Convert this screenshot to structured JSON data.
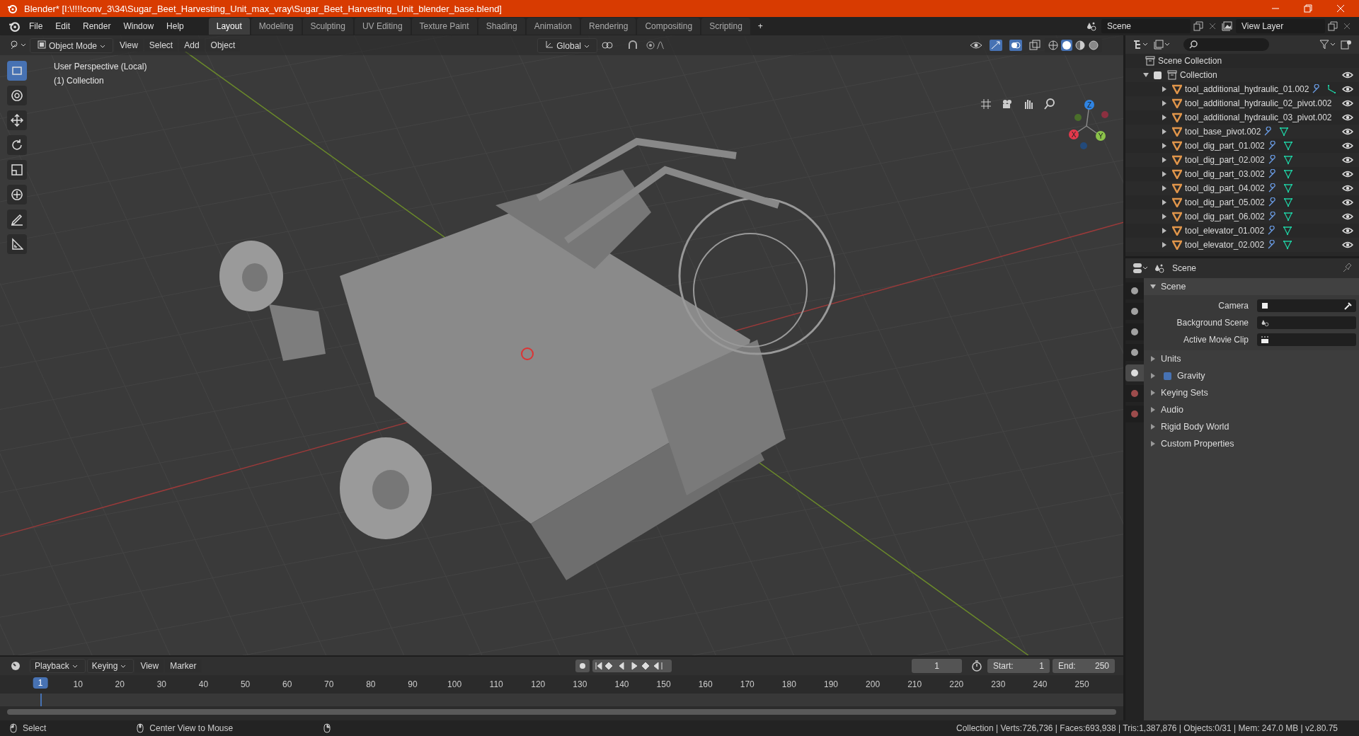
{
  "window": {
    "title": "Blender* [I:\\!!!!conv_3\\34\\Sugar_Beet_Harvesting_Unit_max_vray\\Sugar_Beet_Harvesting_Unit_blender_base.blend]"
  },
  "menu": [
    "File",
    "Edit",
    "Render",
    "Window",
    "Help"
  ],
  "workspaces": [
    {
      "label": "Layout",
      "selected": true
    },
    {
      "label": "Modeling",
      "selected": false
    },
    {
      "label": "Sculpting",
      "selected": false
    },
    {
      "label": "UV Editing",
      "selected": false
    },
    {
      "label": "Texture Paint",
      "selected": false
    },
    {
      "label": "Shading",
      "selected": false
    },
    {
      "label": "Animation",
      "selected": false
    },
    {
      "label": "Rendering",
      "selected": false
    },
    {
      "label": "Compositing",
      "selected": false
    },
    {
      "label": "Scripting",
      "selected": false
    }
  ],
  "add_workspace": "+",
  "scene_field": {
    "value": "Scene"
  },
  "view_layer_field": {
    "value": "View Layer"
  },
  "viewport_header": {
    "mode": "Object Mode",
    "menus": [
      "View",
      "Select",
      "Add",
      "Object"
    ],
    "orientation": "Global"
  },
  "viewport": {
    "overlay_lines": [
      "User Perspective (Local)",
      "(1) Collection"
    ],
    "gizmo_axes": [
      "X",
      "Y",
      "Z"
    ]
  },
  "toolbar": [
    {
      "kind": "select",
      "selected": true
    },
    {
      "kind": "cursor",
      "selected": false
    },
    {
      "kind": "move",
      "selected": false
    },
    {
      "kind": "rotate",
      "selected": false
    },
    {
      "kind": "scale",
      "selected": false
    },
    {
      "kind": "transform",
      "selected": false
    },
    {
      "kind": "annotate",
      "selected": false
    },
    {
      "kind": "measure",
      "selected": false
    }
  ],
  "outliner": {
    "root": "Scene Collection",
    "collection": {
      "label": "Collection",
      "expanded": true,
      "checked": true,
      "children": [
        {
          "label": "tool_additional_hydraulic_01.002",
          "kind": "modified_link"
        },
        {
          "label": "tool_additional_hydraulic_02_pivot.002",
          "kind": "plain"
        },
        {
          "label": "tool_additional_hydraulic_03_pivot.002",
          "kind": "plain"
        },
        {
          "label": "tool_base_pivot.002",
          "kind": "modified_mesh"
        },
        {
          "label": "tool_dig_part_01.002",
          "kind": "modified_mesh"
        },
        {
          "label": "tool_dig_part_02.002",
          "kind": "modified_mesh"
        },
        {
          "label": "tool_dig_part_03.002",
          "kind": "modified_mesh"
        },
        {
          "label": "tool_dig_part_04.002",
          "kind": "modified_mesh"
        },
        {
          "label": "tool_dig_part_05.002",
          "kind": "modified_mesh"
        },
        {
          "label": "tool_dig_part_06.002",
          "kind": "modified_mesh"
        },
        {
          "label": "tool_elevator_01.002",
          "kind": "modified_mesh"
        },
        {
          "label": "tool_elevator_02.002",
          "kind": "modified_mesh"
        }
      ]
    }
  },
  "properties": {
    "context": "Scene",
    "tabs": [
      {
        "kind": "tool",
        "selected": false
      },
      {
        "kind": "render",
        "selected": false
      },
      {
        "kind": "output",
        "selected": false
      },
      {
        "kind": "view_layer",
        "selected": false
      },
      {
        "kind": "scene",
        "selected": true
      },
      {
        "kind": "world",
        "selected": false
      },
      {
        "kind": "texture",
        "selected": false
      }
    ],
    "panel": {
      "title": "Scene",
      "expanded": true,
      "fields": [
        {
          "label": "Camera",
          "kind": "camera"
        },
        {
          "label": "Background Scene",
          "kind": "scene"
        },
        {
          "label": "Active Movie Clip",
          "kind": "clip"
        }
      ]
    },
    "subpanels": [
      {
        "label": "Units",
        "kind": "plain"
      },
      {
        "label": "Gravity",
        "kind": "toggle",
        "checked": true
      },
      {
        "label": "Keying Sets",
        "kind": "plain"
      },
      {
        "label": "Audio",
        "kind": "plain"
      },
      {
        "label": "Rigid Body World",
        "kind": "plain"
      },
      {
        "label": "Custom Properties",
        "kind": "plain"
      }
    ]
  },
  "timeline": {
    "menus": [
      "Playback",
      "Keying",
      "View",
      "Marker"
    ],
    "current_frame": "1",
    "start_label": "Start:",
    "start": "1",
    "end_label": "End:",
    "end": "250",
    "ruler": [
      {
        "label": "1",
        "selected": true
      },
      {
        "label": "10",
        "selected": false
      },
      {
        "label": "20",
        "selected": false
      },
      {
        "label": "30",
        "selected": false
      },
      {
        "label": "40",
        "selected": false
      },
      {
        "label": "50",
        "selected": false
      },
      {
        "label": "60",
        "selected": false
      },
      {
        "label": "70",
        "selected": false
      },
      {
        "label": "80",
        "selected": false
      },
      {
        "label": "90",
        "selected": false
      },
      {
        "label": "100",
        "selected": false
      },
      {
        "label": "110",
        "selected": false
      },
      {
        "label": "120",
        "selected": false
      },
      {
        "label": "130",
        "selected": false
      },
      {
        "label": "140",
        "selected": false
      },
      {
        "label": "150",
        "selected": false
      },
      {
        "label": "160",
        "selected": false
      },
      {
        "label": "170",
        "selected": false
      },
      {
        "label": "180",
        "selected": false
      },
      {
        "label": "190",
        "selected": false
      },
      {
        "label": "200",
        "selected": false
      },
      {
        "label": "210",
        "selected": false
      },
      {
        "label": "220",
        "selected": false
      },
      {
        "label": "230",
        "selected": false
      },
      {
        "label": "240",
        "selected": false
      },
      {
        "label": "250",
        "selected": false
      }
    ]
  },
  "status_bar": {
    "hints": [
      "Select",
      "Center View to Mouse"
    ],
    "stats": "Collection | Verts:726,736 | Faces:693,938 | Tris:1,387,876 | Objects:0/31 | Mem: 247.0 MB | v2.80.75"
  }
}
